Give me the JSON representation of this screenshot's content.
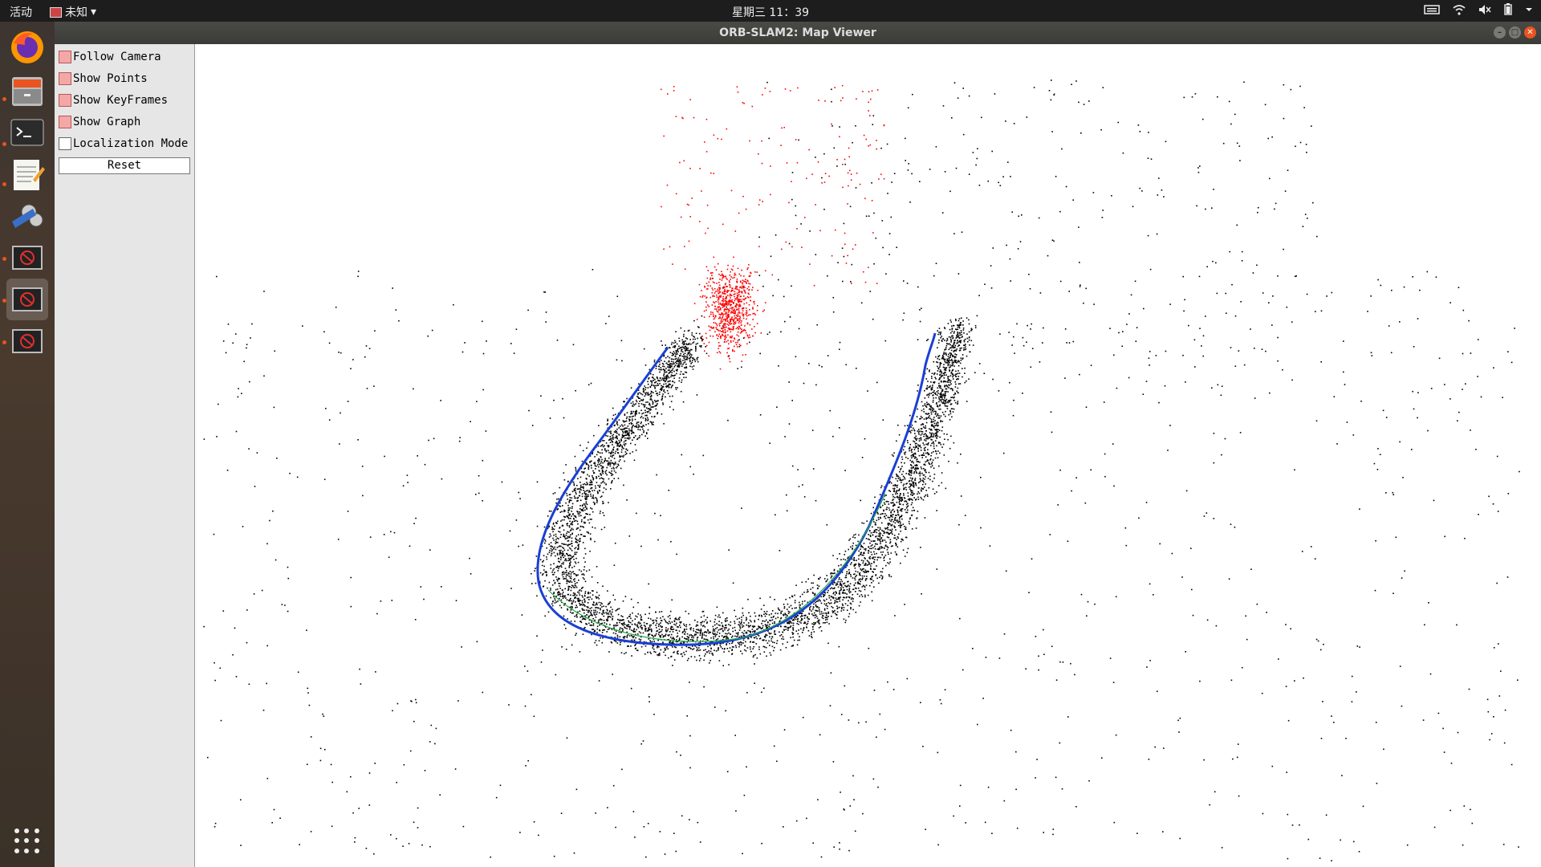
{
  "topbar": {
    "activities": "活动",
    "app_menu": "未知",
    "clock": "星期三 11：39",
    "tray_icons": [
      "keyboard-icon",
      "wifi-icon",
      "volume-muted-icon",
      "battery-icon",
      "chevron-down-icon"
    ]
  },
  "window": {
    "title": "ORB-SLAM2: Map Viewer"
  },
  "dock": {
    "items": [
      "firefox-icon",
      "files-icon",
      "terminal-icon",
      "text-editor-icon",
      "video-editor-icon",
      "blocked-app-icon",
      "blocked-app-icon",
      "blocked-app-icon"
    ],
    "show_apps": "grid-icon"
  },
  "panel": {
    "follow_camera": {
      "label": "Follow Camera",
      "checked": true
    },
    "show_points": {
      "label": "Show Points",
      "checked": true
    },
    "show_keyframes": {
      "label": "Show KeyFrames",
      "checked": true
    },
    "show_graph": {
      "label": "Show Graph",
      "checked": true
    },
    "localization_mode": {
      "label": "Localization Mode",
      "checked": false
    },
    "reset": "Reset"
  },
  "colors": {
    "map_points": "#000000",
    "reference_points": "#ff0000",
    "trajectory": "#1a3fd6",
    "graph": "#22aa44",
    "accent": "#e95420"
  }
}
